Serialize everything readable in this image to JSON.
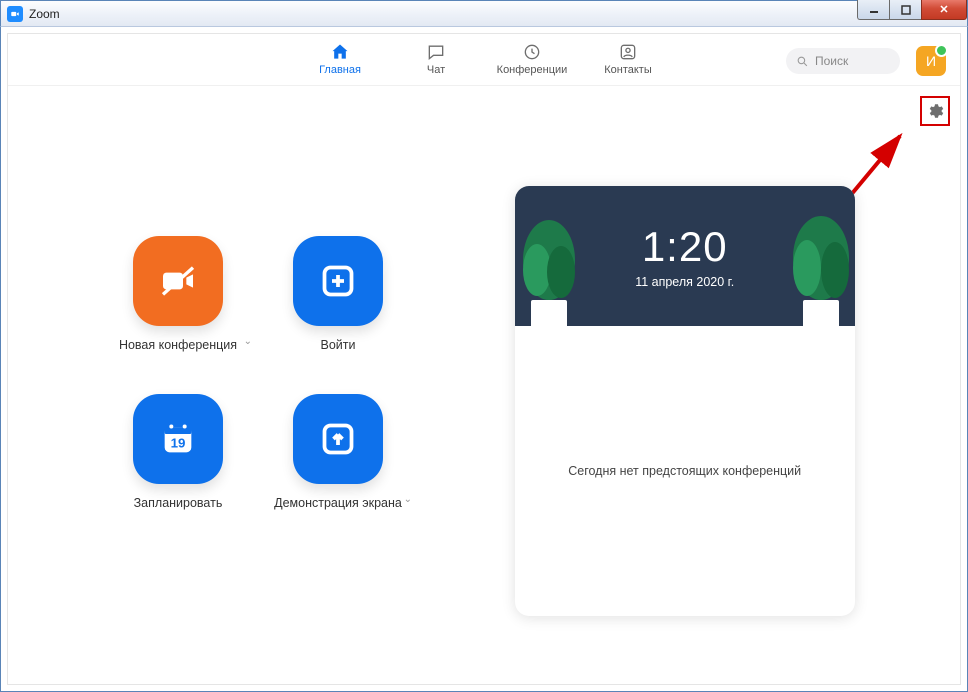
{
  "titlebar": {
    "app_name": "Zoom"
  },
  "nav": {
    "tabs": {
      "home": {
        "label": "Главная"
      },
      "chat": {
        "label": "Чат"
      },
      "meet": {
        "label": "Конференции"
      },
      "cont": {
        "label": "Контакты"
      }
    },
    "search_placeholder": "Поиск",
    "avatar_initial": "И"
  },
  "actions": {
    "new_meeting": {
      "label": "Новая конференция"
    },
    "join": {
      "label": "Войти"
    },
    "schedule": {
      "label": "Запланировать",
      "day": "19"
    },
    "share": {
      "label": "Демонстрация экрана"
    }
  },
  "card": {
    "time": "1:20",
    "date": "11 апреля 2020 г.",
    "empty_text": "Сегодня нет предстоящих конференций"
  }
}
